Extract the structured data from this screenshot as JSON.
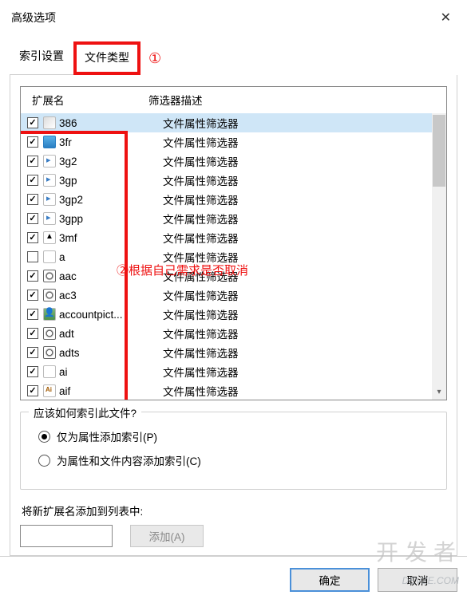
{
  "window": {
    "title": "高级选项",
    "close": "✕"
  },
  "tabs": {
    "settings": "索引设置",
    "file_types": "文件类型"
  },
  "annotations": {
    "num1": "①",
    "num2": "②根据自己需求是否取消"
  },
  "list": {
    "headers": {
      "ext": "扩展名",
      "desc": "筛选器描述"
    },
    "rows": [
      {
        "checked": true,
        "icon": "sys",
        "ext": "386",
        "desc": "文件属性筛选器",
        "selected": true
      },
      {
        "checked": true,
        "icon": "img",
        "ext": "3fr",
        "desc": "文件属性筛选器"
      },
      {
        "checked": true,
        "icon": "vid",
        "ext": "3g2",
        "desc": "文件属性筛选器"
      },
      {
        "checked": true,
        "icon": "vid",
        "ext": "3gp",
        "desc": "文件属性筛选器"
      },
      {
        "checked": true,
        "icon": "vid",
        "ext": "3gp2",
        "desc": "文件属性筛选器"
      },
      {
        "checked": true,
        "icon": "vid",
        "ext": "3gpp",
        "desc": "文件属性筛选器"
      },
      {
        "checked": true,
        "icon": "tri",
        "ext": "3mf",
        "desc": "文件属性筛选器"
      },
      {
        "checked": false,
        "icon": "blank",
        "ext": "a",
        "desc": "文件属性筛选器"
      },
      {
        "checked": true,
        "icon": "aud",
        "ext": "aac",
        "desc": "文件属性筛选器"
      },
      {
        "checked": true,
        "icon": "aud",
        "ext": "ac3",
        "desc": "文件属性筛选器"
      },
      {
        "checked": true,
        "icon": "person",
        "ext": "accountpict...",
        "desc": "文件属性筛选器"
      },
      {
        "checked": true,
        "icon": "aud",
        "ext": "adt",
        "desc": "文件属性筛选器"
      },
      {
        "checked": true,
        "icon": "aud",
        "ext": "adts",
        "desc": "文件属性筛选器"
      },
      {
        "checked": true,
        "icon": "blank",
        "ext": "ai",
        "desc": "文件属性筛选器"
      },
      {
        "checked": true,
        "icon": "ai",
        "ext": "aif",
        "desc": "文件属性筛选器"
      }
    ]
  },
  "group": {
    "title": "应该如何索引此文件?",
    "opt1": "仅为属性添加索引(P)",
    "opt2": "为属性和文件内容添加索引(C)",
    "selected": 0
  },
  "add": {
    "label": "将新扩展名添加到列表中:",
    "value": "",
    "button": "添加(A)"
  },
  "buttons": {
    "ok": "确定",
    "cancel": "取消"
  },
  "watermark": {
    "big": "开发者",
    "small": "DEVZE.COM"
  }
}
